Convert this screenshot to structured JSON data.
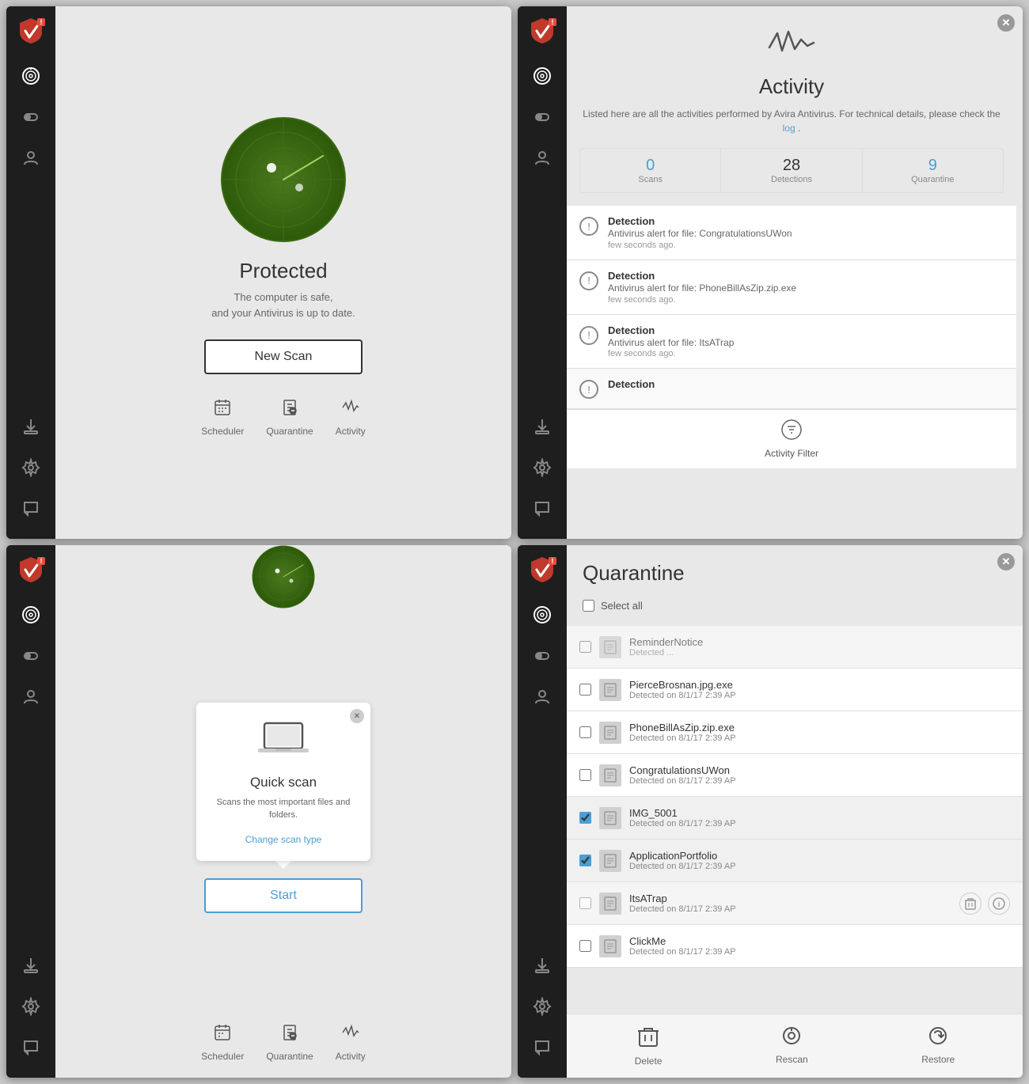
{
  "panels": {
    "p1": {
      "protected_title": "Protected",
      "protected_subtitle_line1": "The computer is safe,",
      "protected_subtitle_line2": "and your Antivirus is up to date.",
      "new_scan_label": "New Scan",
      "nav_scheduler": "Scheduler",
      "nav_quarantine": "Quarantine",
      "nav_activity": "Activity"
    },
    "p2": {
      "title": "Activity",
      "desc_before": "Listed here are all the activities performed by Avira Antivirus. For technical details, please check the",
      "desc_link": "log",
      "desc_after": ".",
      "scans_count": "0",
      "scans_label": "Scans",
      "detections_count": "28",
      "detections_label": "Detections",
      "quarantine_count": "9",
      "quarantine_label": "Quarantine",
      "detections": [
        {
          "title": "Detection",
          "body": "Antivirus alert for file: CongratulationsUWon",
          "time": "few seconds ago."
        },
        {
          "title": "Detection",
          "body": "Antivirus alert for file: PhoneBillAsZip.zip.exe",
          "time": "few seconds ago."
        },
        {
          "title": "Detection",
          "body": "Antivirus alert for file: ItsATrap",
          "time": "few seconds ago."
        },
        {
          "title": "Detection",
          "body": "",
          "time": ""
        }
      ],
      "filter_label": "Activity Filter"
    },
    "p3": {
      "quick_scan_title": "Quick scan",
      "quick_scan_desc": "Scans the most important files and folders.",
      "change_scan_label": "Change scan type",
      "start_label": "Start",
      "nav_scheduler": "Scheduler",
      "nav_quarantine": "Quarantine",
      "nav_activity": "Activity"
    },
    "p4": {
      "title": "Quarantine",
      "select_all": "Select all",
      "items": [
        {
          "name": "ReminderNotice",
          "date": "Detected ...",
          "checked": false,
          "partial": true
        },
        {
          "name": "PierceBrosnan.jpg.exe",
          "date": "Detected on 8/1/17 2:39 AP",
          "checked": false,
          "partial": false
        },
        {
          "name": "PhoneBillAsZip.zip.exe",
          "date": "Detected on 8/1/17 2:39 AP",
          "checked": false,
          "partial": false
        },
        {
          "name": "CongratulationsUWon",
          "date": "Detected on 8/1/17 2:39 AP",
          "checked": false,
          "partial": false
        },
        {
          "name": "IMG_5001",
          "date": "Detected on 8/1/17 2:39 AP",
          "checked": true,
          "partial": false
        },
        {
          "name": "ApplicationPortfolio",
          "date": "Detected on 8/1/17 2:39 AP",
          "checked": true,
          "partial": false
        },
        {
          "name": "ItsATrap",
          "date": "Detected on 8/1/17 2:39 AP",
          "checked": false,
          "has_actions": true,
          "partial": false
        },
        {
          "name": "ClickMe",
          "date": "Detected on 8/1/17 2:39 AP",
          "checked": false,
          "partial": false
        }
      ],
      "delete_label": "Delete",
      "rescan_label": "Rescan",
      "restore_label": "Restore"
    }
  }
}
